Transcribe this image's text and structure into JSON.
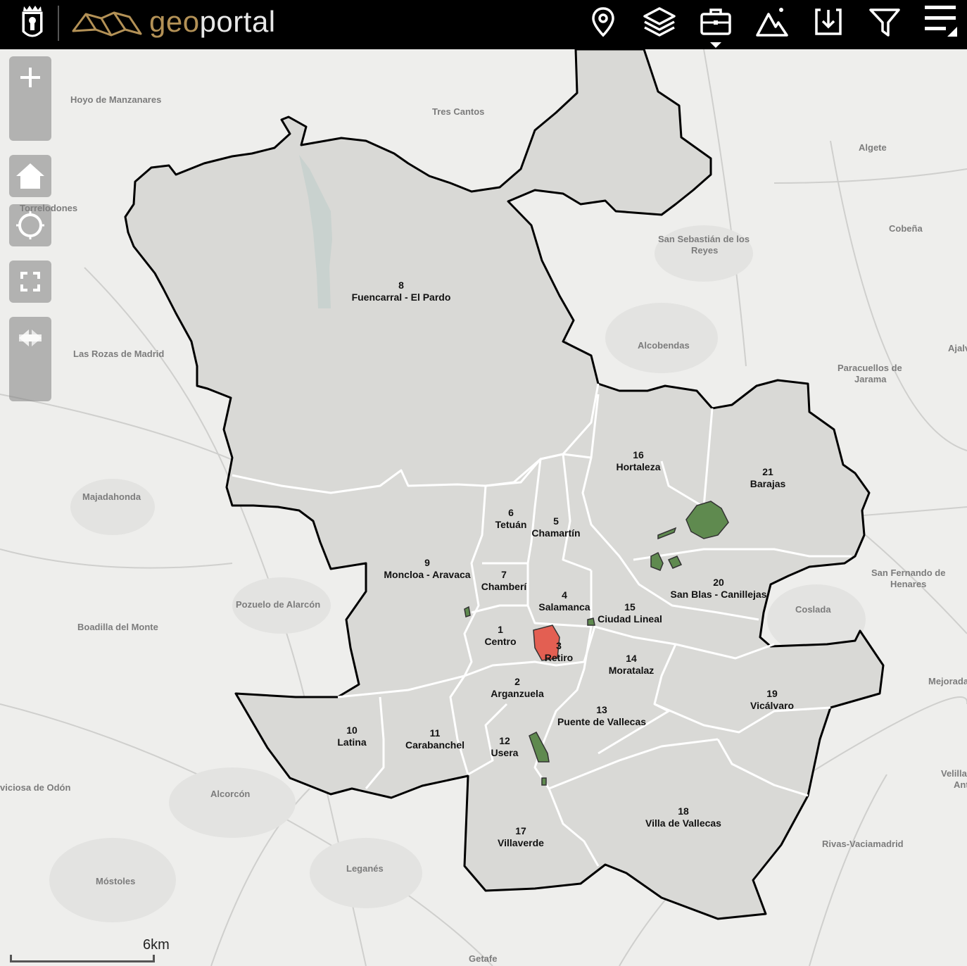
{
  "header": {
    "brand_geo": "geo",
    "brand_portal": "portal",
    "tools": [
      {
        "name": "location-icon"
      },
      {
        "name": "layers-icon"
      },
      {
        "name": "briefcase-icon"
      },
      {
        "name": "mountain-icon"
      },
      {
        "name": "download-icon"
      },
      {
        "name": "filter-icon"
      },
      {
        "name": "menu-icon"
      }
    ]
  },
  "controls": [
    "zoom-in-icon",
    "zoom-out-icon",
    "home-icon",
    "locate-icon",
    "fullscreen-icon",
    "back-arrow-icon",
    "forward-arrow-icon"
  ],
  "scale": {
    "label": "6km"
  },
  "colors": {
    "boundary": "#000000",
    "district_line": "#ffffff",
    "green_area": "#5f8a4f",
    "red_area": "#e35f52",
    "region_fill": "#d6d6d3"
  },
  "districts": [
    {
      "num": "8",
      "name": "Fuencarral - El Pardo"
    },
    {
      "num": "16",
      "name": "Hortaleza"
    },
    {
      "num": "21",
      "name": "Barajas"
    },
    {
      "num": "6",
      "name": "Tetuán"
    },
    {
      "num": "5",
      "name": "Chamartín"
    },
    {
      "num": "9",
      "name": "Moncloa - Aravaca"
    },
    {
      "num": "7",
      "name": "Chamberí"
    },
    {
      "num": "4",
      "name": "Salamanca"
    },
    {
      "num": "15",
      "name": "Ciudad Lineal"
    },
    {
      "num": "20",
      "name": "San Blas - Canillejas"
    },
    {
      "num": "1",
      "name": "Centro"
    },
    {
      "num": "3",
      "name": "Retiro"
    },
    {
      "num": "14",
      "name": "Moratalaz"
    },
    {
      "num": "2",
      "name": "Arganzuela"
    },
    {
      "num": "19",
      "name": "Vicálvaro"
    },
    {
      "num": "13",
      "name": "Puente de Vallecas"
    },
    {
      "num": "10",
      "name": "Latina"
    },
    {
      "num": "11",
      "name": "Carabanchel"
    },
    {
      "num": "12",
      "name": "Usera"
    },
    {
      "num": "18",
      "name": "Villa de Vallecas"
    },
    {
      "num": "17",
      "name": "Villaverde"
    }
  ],
  "places": [
    "Hoyo de Manzanares",
    "Tres Cantos",
    "Algete",
    "Torrelodones",
    "Cobeña",
    "San Sebastián de los",
    "Reyes",
    "Alcobendas",
    "Ajalv",
    "Paracuellos de",
    "Jarama",
    "Las Rozas de Madrid",
    "Majadahonda",
    "San Fernando de",
    "Henares",
    "Pozuelo de Alarcón",
    "Coslada",
    "Boadilla del Monte",
    "Mejorada",
    "viciosa de Odón",
    "Alcorcón",
    "Velilla",
    "Ant",
    "Rivas-Vaciamadrid",
    "Leganés",
    "Móstoles",
    "Getafe"
  ]
}
